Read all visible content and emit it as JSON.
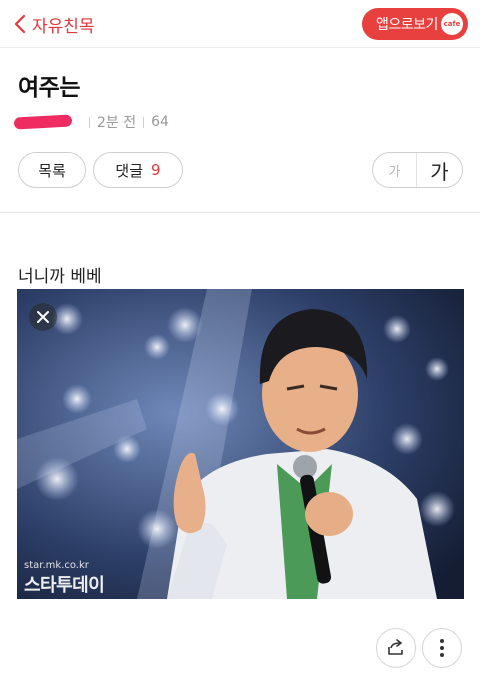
{
  "header": {
    "back_label": "자유친목",
    "app_button_label": "앱으로보기",
    "app_badge": "cafe"
  },
  "post": {
    "title": "여주는",
    "time": "2분 전",
    "views": "64",
    "list_label": "목록",
    "comment_label": "댓글",
    "comment_count": "9",
    "font_small": "가",
    "font_large": "가",
    "body_text": "너니까 베베"
  },
  "image": {
    "watermark_url": "star.mk.co.kr",
    "watermark_brand": "스타투데이"
  },
  "colors": {
    "accent": "#e4373a",
    "author_redaction": "#ee2c62"
  }
}
